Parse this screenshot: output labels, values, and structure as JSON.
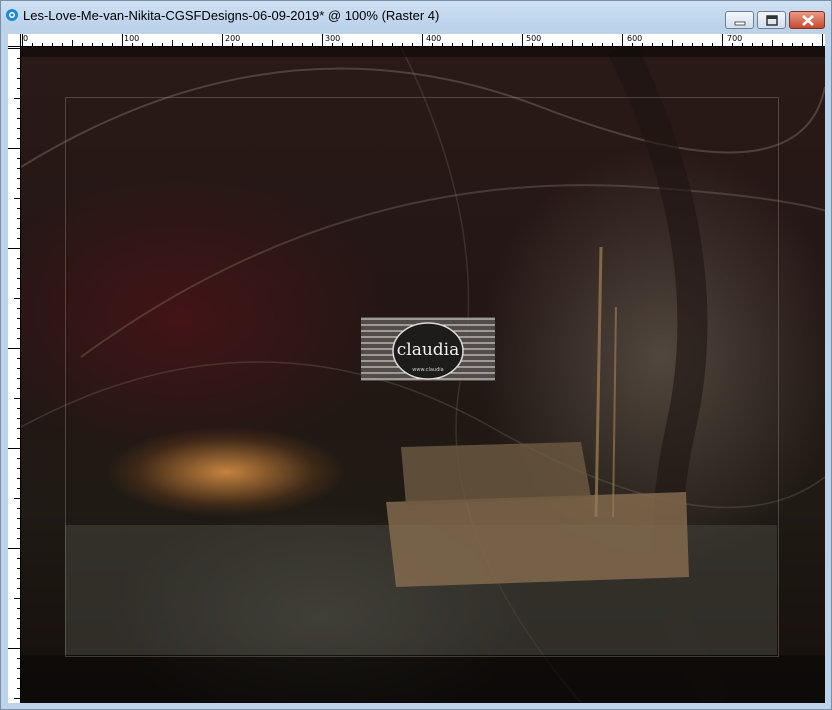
{
  "window": {
    "title": "Les-Love-Me-van-Nikita-CGSFDesigns-06-09-2019* @ 100% (Raster 4)",
    "buttons": {
      "minimize": "minimize",
      "maximize": "maximize",
      "close": "close"
    }
  },
  "ruler": {
    "labels": [
      "0",
      "100",
      "200",
      "300",
      "400",
      "500",
      "600",
      "700"
    ]
  },
  "canvas": {
    "watermark": {
      "text": "claudia",
      "subtext": "www.claudia"
    }
  },
  "colors": {
    "titlebar": "#bcd3ea",
    "close": "#c74a30",
    "ruler": "#ffffff"
  }
}
